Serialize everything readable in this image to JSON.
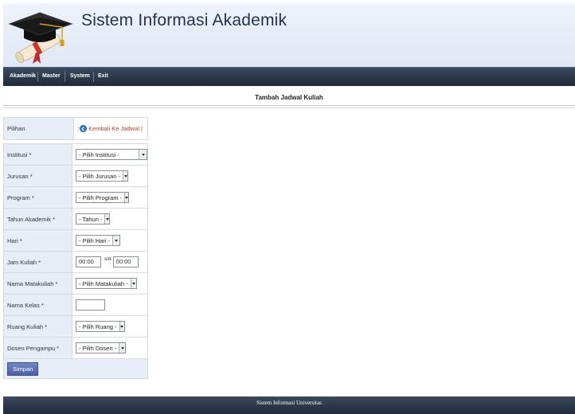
{
  "header": {
    "title": "Sistem Informasi Akademik",
    "logo_icon": "graduation-cap-diploma-icon"
  },
  "nav": {
    "items": [
      "Akademik",
      "Master",
      "System",
      "Exit"
    ]
  },
  "page": {
    "heading": "Tambah Jadwal Kuliah"
  },
  "pilihan": {
    "label": "Pilihan",
    "colon": ":",
    "link": "Kembali Ke Jadwal |",
    "icon": "back-circle-icon"
  },
  "form": {
    "institusi": {
      "label": "Institusi *",
      "value": "- Pilih Institusi -"
    },
    "jurusan": {
      "label": "Jurusan *",
      "value": "- Pilih Jurusan -"
    },
    "program": {
      "label": "Program *",
      "value": "- Pilih Program -"
    },
    "tahun": {
      "label": "Tahun Akademik *",
      "value": "- Tahun -"
    },
    "hari": {
      "label": "Hari *",
      "value": "- Pilih Hari -"
    },
    "jam": {
      "label": "Jam Kuliah *",
      "start": "00:00",
      "separator": "s/d",
      "end": "00:00"
    },
    "matakuliah": {
      "label": "Nama Matakuliah *",
      "value": "- Pilih Matakuliah -"
    },
    "kelas": {
      "label": "Nama Kelas *",
      "value": ""
    },
    "ruang": {
      "label": "Ruang Kuliah *",
      "value": "- Pilih Ruang -"
    },
    "dosen": {
      "label": "Dosen Pengampu *",
      "value": "- Pilih Dosen -"
    },
    "submit_label": "Simpan"
  },
  "footer": {
    "text": "Sistem Informasi Universitas"
  },
  "colors": {
    "nav_bg": "#1f2a3a",
    "label_bg": "#e7edf7",
    "title": "#24324f",
    "link": "#c0392b",
    "button": "#4a62a6"
  }
}
